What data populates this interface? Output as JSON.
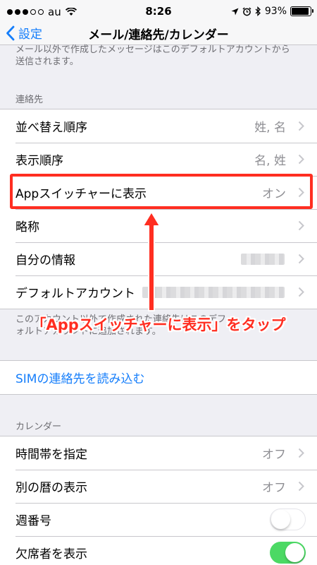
{
  "status_bar": {
    "carrier": "au",
    "time": "8:26",
    "battery": "93%",
    "battery_level": 0.93
  },
  "nav": {
    "back_label": "設定",
    "title": "メール/連絡先/カレンダー"
  },
  "mail_footer": "メール以外で作成したメッセージはこのデフォルトアカウントから送信されます。",
  "contacts": {
    "header": "連絡先",
    "rows": [
      {
        "label": "並べ替え順序",
        "value": "姓, 名"
      },
      {
        "label": "表示順序",
        "value": "名, 姓"
      },
      {
        "label": "Appスイッチャーに表示",
        "value": "オン"
      },
      {
        "label": "略称",
        "value": ""
      },
      {
        "label": "自分の情報",
        "value": ""
      },
      {
        "label": "デフォルトアカウント",
        "value": ""
      }
    ],
    "footer": "このアカウント以外で作成された連絡先はこのデフォルトアカウントに追加されます。"
  },
  "sim": {
    "label": "SIMの連絡先を読み込む"
  },
  "calendar": {
    "header": "カレンダー",
    "rows": [
      {
        "label": "時間帯を指定",
        "value": "オフ"
      },
      {
        "label": "別の暦の表示",
        "value": "オフ"
      },
      {
        "label": "週番号",
        "toggle": false
      },
      {
        "label": "欠席者を表示",
        "toggle": true
      }
    ]
  },
  "annotation": {
    "text": "「Appスイッチャーに表示」をタップ",
    "color": "#ff2e21"
  },
  "colors": {
    "accent": "#157efb",
    "toggle_on": "#4cd964",
    "background": "#efeff4"
  }
}
